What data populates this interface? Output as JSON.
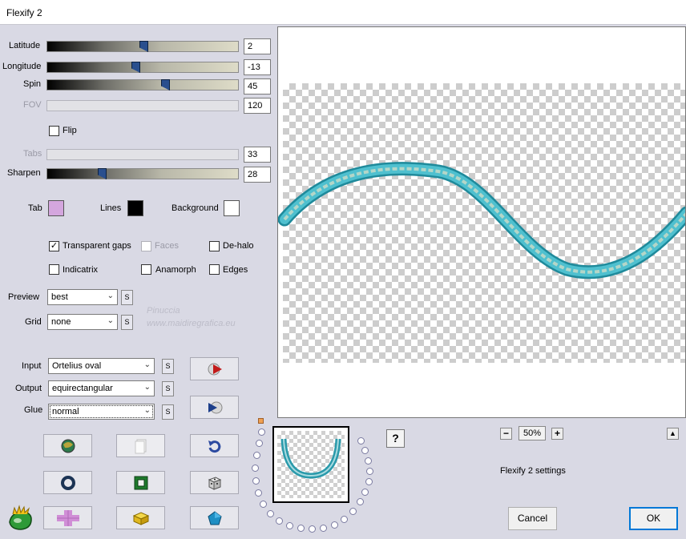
{
  "window": {
    "title": "Flexify 2"
  },
  "sliders": [
    {
      "id": "latitude",
      "label": "Latitude",
      "value": "2",
      "enabled": true,
      "level": 0.5
    },
    {
      "id": "longitude",
      "label": "Longitude",
      "value": "-13",
      "enabled": true,
      "level": 0.46
    },
    {
      "id": "spin",
      "label": "Spin",
      "value": "45",
      "enabled": true,
      "level": 0.62
    },
    {
      "id": "fov",
      "label": "FOV",
      "value": "120",
      "enabled": false
    },
    {
      "id": "tabs",
      "label": "Tabs",
      "value": "33",
      "enabled": false
    },
    {
      "id": "sharpen",
      "label": "Sharpen",
      "value": "28",
      "enabled": true,
      "level": 0.28
    }
  ],
  "flip": {
    "label": "Flip",
    "checked": false
  },
  "colors": {
    "tab": {
      "label": "Tab",
      "color": "#d4a6de"
    },
    "lines": {
      "label": "Lines",
      "color": "#000000"
    },
    "background": {
      "label": "Background",
      "color": "#ffffff"
    }
  },
  "options": {
    "transparent_gaps": {
      "label": "Transparent gaps",
      "checked": true
    },
    "faces": {
      "label": "Faces",
      "checked": false,
      "enabled": false
    },
    "de_halo": {
      "label": "De-halo",
      "checked": false
    },
    "indicatrix": {
      "label": "Indicatrix",
      "checked": false
    },
    "anamorph": {
      "label": "Anamorph",
      "checked": false
    },
    "edges": {
      "label": "Edges",
      "checked": false
    }
  },
  "preview": {
    "label": "Preview",
    "value": "best",
    "s": "S"
  },
  "grid": {
    "label": "Grid",
    "value": "none",
    "s": "S"
  },
  "watermark": {
    "line1": "Pinuccia",
    "line2": "www.maidiregrafica.eu"
  },
  "input": {
    "label": "Input",
    "value": "Ortelius oval",
    "s": "S"
  },
  "output": {
    "label": "Output",
    "value": "equirectangular",
    "s": "S"
  },
  "glue": {
    "label": "Glue",
    "value": "normal",
    "s": "S"
  },
  "zoom": {
    "minus": "−",
    "value": "50%",
    "plus": "+"
  },
  "help": {
    "label": "?"
  },
  "collapse": {
    "label": "▲"
  },
  "status": {
    "text": "Flexify 2 settings"
  },
  "buttons": {
    "cancel": "Cancel",
    "ok": "OK"
  },
  "icons": {
    "logo": "flexify-logo-icon",
    "tool_buttons": [
      "globe-icon",
      "copy-icon",
      "undo-icon",
      "ring-icon",
      "frame-icon",
      "dice-icon",
      "plus-tiles-icon",
      "cube-icon",
      "pentagon-icon"
    ]
  }
}
